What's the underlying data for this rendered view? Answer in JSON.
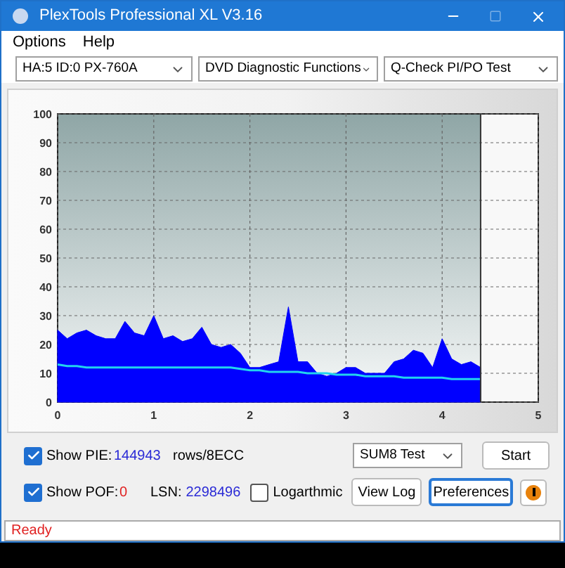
{
  "window": {
    "title": "PlexTools Professional XL V3.16"
  },
  "menu": [
    "Options",
    "Help"
  ],
  "toolbar": {
    "drive": "HA:5 ID:0  PX-760A",
    "function": "DVD Diagnostic Functions",
    "test": "Q-Check PI/PO Test"
  },
  "chart_data": {
    "type": "area",
    "x": [
      0,
      0.1,
      0.2,
      0.3,
      0.4,
      0.5,
      0.6,
      0.7,
      0.8,
      0.9,
      1.0,
      1.1,
      1.2,
      1.3,
      1.4,
      1.5,
      1.6,
      1.7,
      1.8,
      1.9,
      2.0,
      2.1,
      2.2,
      2.3,
      2.4,
      2.5,
      2.6,
      2.7,
      2.8,
      2.9,
      3.0,
      3.1,
      3.2,
      3.3,
      3.4,
      3.5,
      3.6,
      3.7,
      3.8,
      3.9,
      4.0,
      4.1,
      4.2,
      4.3,
      4.4
    ],
    "xlim": [
      0,
      5
    ],
    "ylim": [
      0,
      100
    ],
    "xticks": [
      0,
      1,
      2,
      3,
      4,
      5
    ],
    "yticks": [
      0,
      10,
      20,
      30,
      40,
      50,
      60,
      70,
      80,
      90,
      100
    ],
    "grid": true,
    "ref_lines": [
      {
        "axis": "x",
        "value": 4.4,
        "color": "#333333"
      }
    ],
    "bands": [
      {
        "axis": "x",
        "from": 4.4,
        "to": 5,
        "color": "#f8f8f8"
      }
    ],
    "series": [
      {
        "color": "#0000ff",
        "values": [
          25,
          22,
          24,
          25,
          23,
          22,
          22,
          28,
          24,
          23,
          30,
          22,
          23,
          21,
          22,
          26,
          20,
          19,
          20,
          17,
          12,
          12,
          13,
          14,
          33,
          14,
          14,
          10,
          9,
          10,
          12,
          12,
          10,
          10,
          10,
          14,
          15,
          18,
          17,
          12,
          22,
          15,
          13,
          14,
          12
        ]
      },
      {
        "type": "line",
        "color": "#22d3ee",
        "values": [
          13,
          12.5,
          12.5,
          12,
          12,
          12,
          12,
          12,
          12,
          12,
          12,
          12,
          12,
          12,
          12,
          12,
          12,
          12,
          12,
          11.5,
          11,
          11,
          10.5,
          10.5,
          10.5,
          10.5,
          10,
          10,
          10,
          9.5,
          9.5,
          9.5,
          9,
          9,
          9,
          9,
          8.5,
          8.5,
          8.5,
          8.5,
          8.5,
          8,
          8,
          8,
          8
        ]
      }
    ]
  },
  "controls": {
    "show_pie": {
      "label": "Show PIE:",
      "checked": true,
      "value": "144943",
      "unit": "rows/8ECC"
    },
    "show_pof": {
      "label": "Show POF:",
      "checked": true,
      "value": "0"
    },
    "lsn": {
      "label": "LSN:",
      "value": "2298496"
    },
    "logarithmic": {
      "label": "Logarthmic",
      "checked": false
    },
    "test_select": "SUM8 Test",
    "buttons": [
      {
        "label": "Start",
        "focused": false
      },
      {
        "label": "View Log",
        "focused": false
      },
      {
        "label": "Preferences",
        "focused": true
      }
    ]
  },
  "status_bar": "Ready"
}
